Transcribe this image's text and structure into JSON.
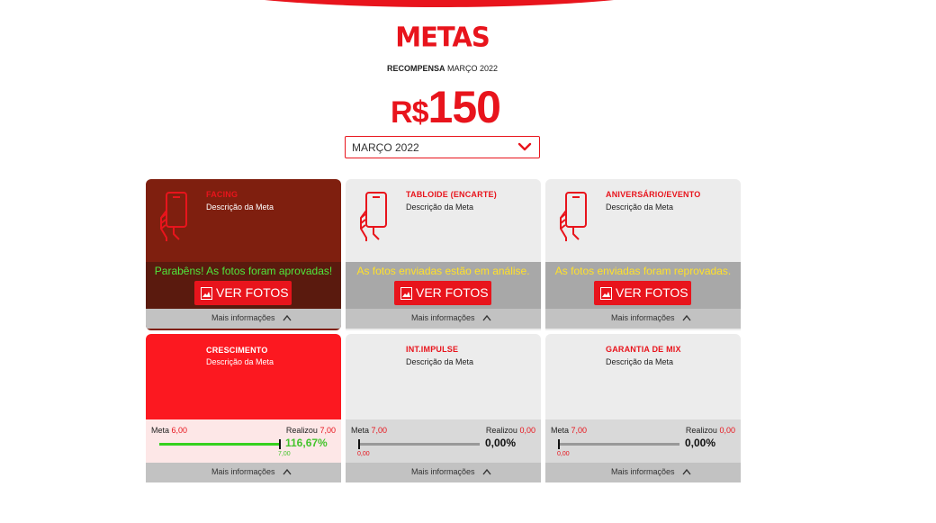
{
  "header": {
    "title": "METAS",
    "reward_bold": "RECOMPENSA",
    "reward_month": "MARÇO 2022",
    "currency": "R$",
    "amount": "150",
    "month_select": "MARÇO 2022"
  },
  "cards": [
    {
      "title": "FACING",
      "desc": "Descrição da Meta",
      "status": "Parabêns! As fotos foram aprovadas!",
      "button": "VER FOTOS",
      "more": "Mais informações"
    },
    {
      "title": "TABLOIDE (ENCARTE)",
      "desc": "Descrição da Meta",
      "status": "As fotos enviadas estão em análise.",
      "button": "VER FOTOS",
      "more": "Mais informações"
    },
    {
      "title": "ANIVERSÁRIO/EVENTO",
      "desc": "Descrição da Meta",
      "status": "As fotos enviadas foram reprovadas.",
      "button": "VER FOTOS",
      "more": "Mais informações"
    },
    {
      "title": "CRESCIMENTO",
      "desc": "Descrição da Meta",
      "meta_label": "Meta",
      "meta_value": "6,00",
      "real_label": "Realizou",
      "real_value": "7,00",
      "percent": "116,67%",
      "progress": 1.0,
      "under_value": "7,00",
      "more": "Mais informações"
    },
    {
      "title": "INT.IMPULSE",
      "desc": "Descrição da Meta",
      "meta_label": "Meta",
      "meta_value": "7,00",
      "real_label": "Realizou",
      "real_value": "0,00",
      "percent": "0,00%",
      "progress": 0.0,
      "under_value": "0,00",
      "more": "Mais informações"
    },
    {
      "title": "GARANTIA DE MIX",
      "desc": "Descrição da Meta",
      "meta_label": "Meta",
      "meta_value": "7,00",
      "real_label": "Realizou",
      "real_value": "0,00",
      "percent": "0,00%",
      "progress": 0.0,
      "under_value": "0,00",
      "more": "Mais informações"
    }
  ],
  "colors": {
    "brand_red": "#e8141c",
    "approved_card": "#7f1f0f",
    "growth_card": "#fc1820",
    "success_green": "#44c42c",
    "warning_yellow": "#ffe02a"
  },
  "icons": [
    "hand-phone-icon",
    "photo-icon",
    "chevron-down-icon",
    "chevron-up-icon"
  ]
}
